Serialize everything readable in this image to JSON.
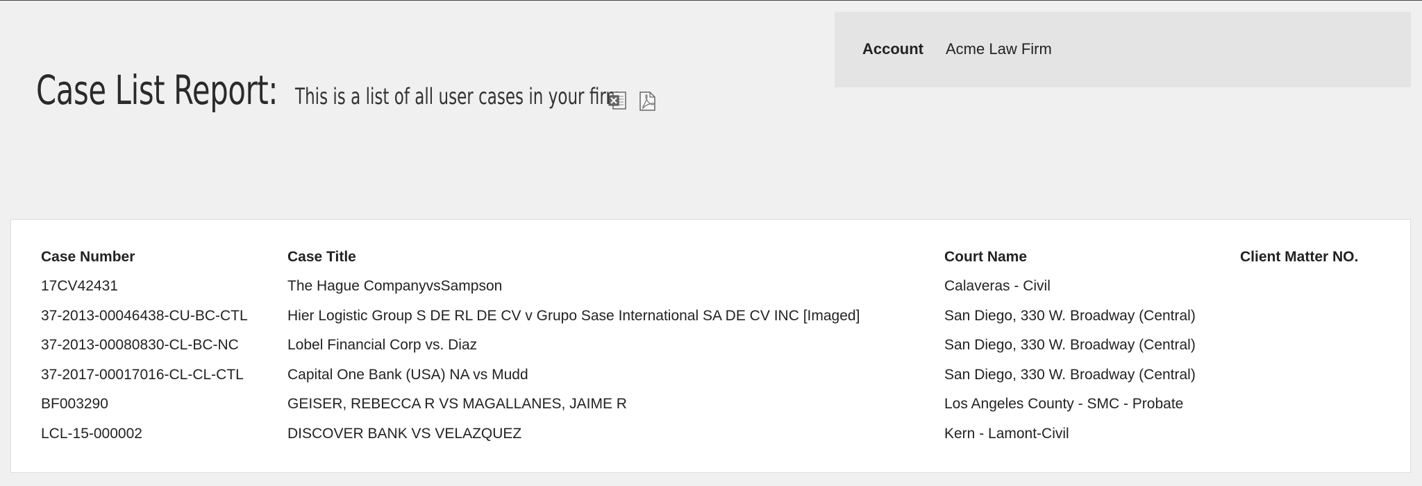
{
  "account": {
    "label": "Account",
    "value": "Acme Law Firm"
  },
  "header": {
    "title": "Case List Report:",
    "subtitle": "This is a list of all user cases in your firm",
    "export_icons": [
      "excel-export-icon",
      "pdf-export-icon"
    ]
  },
  "table": {
    "columns": [
      "Case Number",
      "Case Title",
      "Court Name",
      "Client Matter NO."
    ],
    "rows": [
      [
        "17CV42431",
        "The Hague CompanyvsSampson",
        "Calaveras - Civil",
        ""
      ],
      [
        "37-2013-00046438-CU-BC-CTL",
        "Hier Logistic Group S DE RL DE CV v Grupo Sase International SA DE CV INC [Imaged]",
        "San Diego, 330 W. Broadway (Central)",
        ""
      ],
      [
        "37-2013-00080830-CL-BC-NC",
        "Lobel Financial Corp vs. Diaz",
        "San Diego, 330 W. Broadway (Central)",
        ""
      ],
      [
        "37-2017-00017016-CL-CL-CTL",
        "Capital One Bank (USA) NA vs Mudd",
        "San Diego, 330 W. Broadway (Central)",
        ""
      ],
      [
        "BF003290",
        "GEISER, REBECCA R VS MAGALLANES, JAIME R",
        "Los Angeles County - SMC - Probate",
        ""
      ],
      [
        "LCL-15-000002",
        "DISCOVER BANK VS VELAZQUEZ",
        "Kern - Lamont-Civil",
        ""
      ]
    ]
  }
}
